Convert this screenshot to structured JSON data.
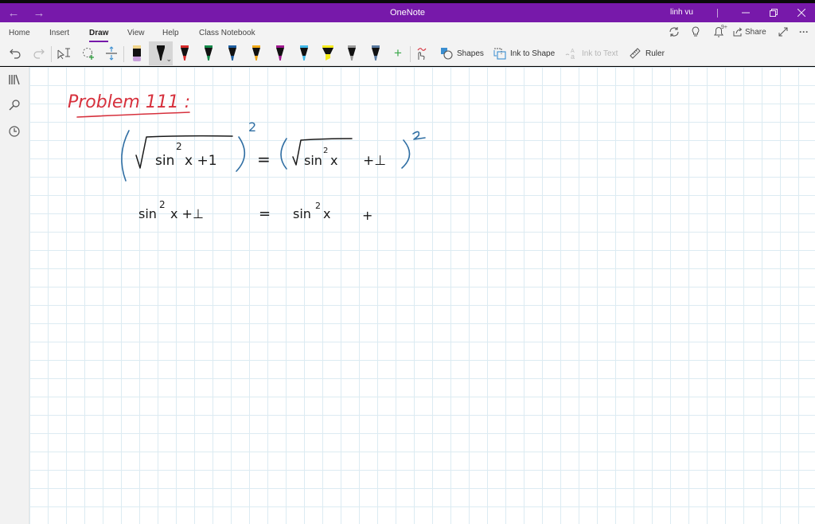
{
  "window": {
    "title": "OneNote",
    "user": "linh vu",
    "back_icon": "arrow-left-icon",
    "forward_icon": "arrow-right-icon",
    "controls": [
      "minimize",
      "restore",
      "close"
    ]
  },
  "ribbon": {
    "tabs": [
      {
        "label": "Home",
        "active": false
      },
      {
        "label": "Insert",
        "active": false
      },
      {
        "label": "Draw",
        "active": true
      },
      {
        "label": "View",
        "active": false
      },
      {
        "label": "Help",
        "active": false
      },
      {
        "label": "Class Notebook",
        "active": false
      }
    ],
    "right_icons": [
      "sync-icon",
      "lightbulb-icon",
      "notification-bell-icon",
      "share-icon",
      "fullscreen-icon",
      "more-icon"
    ],
    "notification_badge": "9+",
    "share_label": "Share",
    "more_label": "···"
  },
  "toolbar": {
    "history": [
      "undo",
      "redo"
    ],
    "select_tools": [
      "type-select",
      "lasso-select",
      "add-space"
    ],
    "pens": [
      {
        "name": "eraser",
        "tip": "#f0d48a",
        "body": "#111111",
        "bottom": "#c8a0dc"
      },
      {
        "name": "black-pen",
        "color": "#111111",
        "selected": true
      },
      {
        "name": "red-pen",
        "color": "#d62a2a"
      },
      {
        "name": "green-pen",
        "color": "#138a4a"
      },
      {
        "name": "blue-pen",
        "color": "#1f5fa0"
      },
      {
        "name": "orange-pen",
        "color": "#f0a818"
      },
      {
        "name": "magenta-pen",
        "color": "#a0188f"
      },
      {
        "name": "cyan-pen",
        "color": "#40b8e8"
      },
      {
        "name": "yellow-highlighter",
        "color": "#f5ea1a"
      },
      {
        "name": "galaxy-pen",
        "color": "#9a9a9a"
      },
      {
        "name": "steel-pen",
        "color": "#5a7aa0"
      }
    ],
    "add_pen_label": "+",
    "tools": [
      {
        "label": "",
        "icon": "ink-replay-icon",
        "enabled": true
      },
      {
        "label": "Shapes",
        "icon": "shapes-icon",
        "enabled": true
      },
      {
        "label": "Ink to Shape",
        "icon": "ink-to-shape-icon",
        "enabled": true
      },
      {
        "label": "Ink to Text",
        "icon": "ink-to-text-icon",
        "enabled": false
      },
      {
        "label": "Ruler",
        "icon": "ruler-icon",
        "enabled": true
      }
    ]
  },
  "sidebar": {
    "items": [
      "notebooks-icon",
      "search-icon",
      "recent-icon"
    ]
  },
  "page": {
    "heading": "Problem 111 :",
    "line1": {
      "left": "(√(sin²x + 1))²",
      "equals": "=",
      "right": "(√(sin²x) + 1)²",
      "exp": "2"
    },
    "line2": {
      "left": "sin²x + 1",
      "equals": "=",
      "right": "sin²x +"
    },
    "colors": {
      "heading": "#d6303c",
      "brackets": "#2f6ea3",
      "text": "#1a1a1a"
    }
  }
}
